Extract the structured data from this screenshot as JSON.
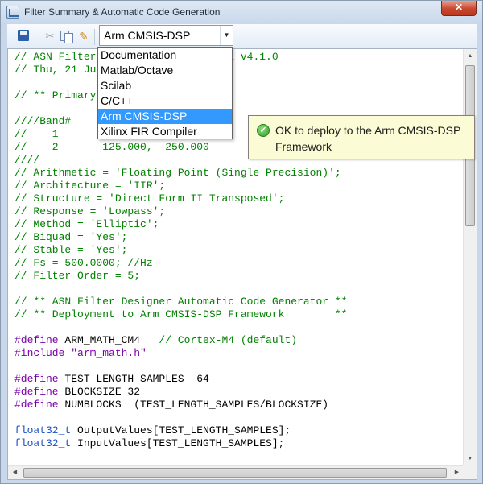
{
  "window": {
    "title": "Filter Summary & Automatic Code Generation",
    "close_label": "✕"
  },
  "toolbar": {
    "icons": [
      "save-icon",
      "cut-icon",
      "copy-icon",
      "edit-icon"
    ],
    "combo_value": "Arm CMSIS-DSP"
  },
  "dropdown": {
    "options": [
      "Documentation",
      "Matlab/Octave",
      "Scilab",
      "C/C++",
      "Arm CMSIS-DSP",
      "Xilinx FIR Compiler"
    ],
    "selected": "Arm CMSIS-DSP"
  },
  "tooltip": {
    "text": "OK to deploy to the Arm CMSIS-DSP Framework",
    "icon": "check-icon"
  },
  "code": {
    "lines": [
      {
        "type": "comment",
        "text": "// ASN Filter Designer Professional v4.1.0"
      },
      {
        "type": "comment",
        "text": "// Thu, 21 Jun"
      },
      {
        "type": "blank",
        "text": ""
      },
      {
        "type": "comment",
        "text": "// ** Primary"
      },
      {
        "type": "blank",
        "text": ""
      },
      {
        "type": "comment",
        "text": "////Band#"
      },
      {
        "type": "comment",
        "text": "//    1"
      },
      {
        "type": "comment",
        "text": "//    2       125.000,  250.000"
      },
      {
        "type": "comment",
        "text": "////"
      },
      {
        "type": "comment",
        "text": "// Arithmetic = 'Floating Point (Single Precision)';"
      },
      {
        "type": "comment",
        "text": "// Architecture = 'IIR';"
      },
      {
        "type": "comment",
        "text": "// Structure = 'Direct Form II Transposed';"
      },
      {
        "type": "comment",
        "text": "// Response = 'Lowpass';"
      },
      {
        "type": "comment",
        "text": "// Method = 'Elliptic';"
      },
      {
        "type": "comment",
        "text": "// Biquad = 'Yes';"
      },
      {
        "type": "comment",
        "text": "// Stable = 'Yes';"
      },
      {
        "type": "comment",
        "text": "// Fs = 500.0000; //Hz"
      },
      {
        "type": "comment",
        "text": "// Filter Order = 5;"
      },
      {
        "type": "blank",
        "text": ""
      },
      {
        "type": "comment",
        "text": "// ** ASN Filter Designer Automatic Code Generator **"
      },
      {
        "type": "comment",
        "text": "// ** Deployment to Arm CMSIS-DSP Framework        **"
      },
      {
        "type": "blank",
        "text": ""
      },
      {
        "type": "define",
        "keyword": "#define",
        "rest": " ARM_MATH_CM4",
        "comment": "   // Cortex-M4 (default)"
      },
      {
        "type": "include",
        "keyword": "#include",
        "str": " \"arm_math.h\""
      },
      {
        "type": "blank",
        "text": ""
      },
      {
        "type": "define",
        "keyword": "#define",
        "rest": " TEST_LENGTH_SAMPLES  64",
        "comment": ""
      },
      {
        "type": "define",
        "keyword": "#define",
        "rest": " BLOCKSIZE 32",
        "comment": ""
      },
      {
        "type": "define",
        "keyword": "#define",
        "rest": " NUMBLOCKS  (TEST_LENGTH_SAMPLES/BLOCKSIZE)",
        "comment": ""
      },
      {
        "type": "blank",
        "text": ""
      },
      {
        "type": "decl",
        "keyword": "float32_t",
        "rest": " OutputValues[TEST_LENGTH_SAMPLES];"
      },
      {
        "type": "decl",
        "keyword": "float32_t",
        "rest": " InputValues[TEST_LENGTH_SAMPLES];"
      }
    ]
  },
  "colors": {
    "comment": "#008000",
    "preprocessor": "#7a00a8",
    "string": "#a31515",
    "type": "#1c4fc2",
    "selection": "#3399ff",
    "tooltip_bg": "#fbfbd5"
  }
}
